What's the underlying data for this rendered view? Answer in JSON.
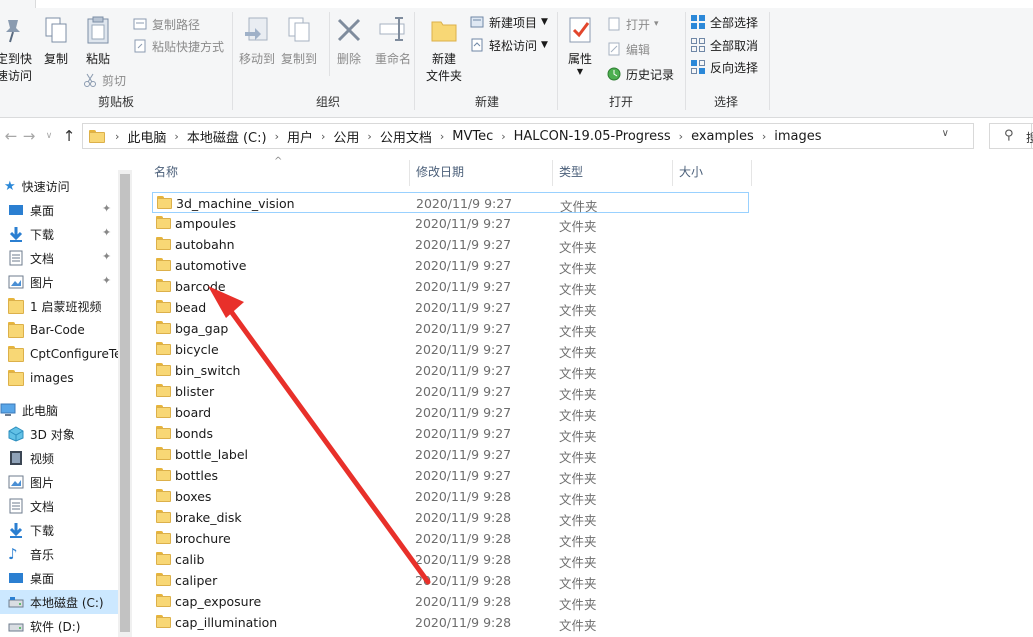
{
  "ribbon": {
    "clipboard": {
      "pin_label_1": "定到快",
      "pin_label_2": "速访问",
      "copy": "复制",
      "paste": "粘贴",
      "copy_path": "复制路径",
      "paste_shortcut": "粘贴快捷方式",
      "cut": "剪切",
      "group": "剪贴板"
    },
    "organize": {
      "move_to": "移动到",
      "copy_to": "复制到",
      "delete": "删除",
      "rename": "重命名",
      "group": "组织"
    },
    "new": {
      "new_folder_1": "新建",
      "new_folder_2": "文件夹",
      "new_item": "新建项目",
      "easy_access": "轻松访问",
      "group": "新建"
    },
    "open": {
      "properties": "属性",
      "open": "打开",
      "edit": "编辑",
      "history": "历史记录",
      "group": "打开"
    },
    "select": {
      "select_all": "全部选择",
      "select_none": "全部取消",
      "invert": "反向选择",
      "group": "选择"
    }
  },
  "address": {
    "crumbs": [
      "此电脑",
      "本地磁盘 (C:)",
      "用户",
      "公用",
      "公用文档",
      "MVTec",
      "HALCON-19.05-Progress",
      "examples",
      "images"
    ],
    "search_placeholder": "搜"
  },
  "nav": {
    "quick_access": "快速访问",
    "items": [
      {
        "label": "桌面",
        "icon": "desktop-icon",
        "pinned": true
      },
      {
        "label": "下载",
        "icon": "download-icon",
        "pinned": true
      },
      {
        "label": "文档",
        "icon": "document-icon",
        "pinned": true
      },
      {
        "label": "图片",
        "icon": "picture-icon",
        "pinned": true
      },
      {
        "label": "1 启蒙班视频",
        "icon": "folder-icon",
        "pinned": false
      },
      {
        "label": "Bar-Code",
        "icon": "folder-icon",
        "pinned": false
      },
      {
        "label": "CptConfigureTe",
        "icon": "folder-icon",
        "pinned": false
      },
      {
        "label": "images",
        "icon": "folder-icon",
        "pinned": false
      }
    ],
    "this_pc": "此电脑",
    "pc_items": [
      {
        "label": "3D 对象",
        "icon": "3d-objects-icon"
      },
      {
        "label": "视频",
        "icon": "video-icon"
      },
      {
        "label": "图片",
        "icon": "picture-icon"
      },
      {
        "label": "文档",
        "icon": "document-icon"
      },
      {
        "label": "下载",
        "icon": "download-icon"
      },
      {
        "label": "音乐",
        "icon": "music-icon"
      },
      {
        "label": "桌面",
        "icon": "desktop-icon"
      },
      {
        "label": "本地磁盘 (C:)",
        "icon": "drive-icon"
      },
      {
        "label": "软件 (D:)",
        "icon": "drive-icon"
      }
    ]
  },
  "columns": {
    "name": "名称",
    "date": "修改日期",
    "type": "类型",
    "size": "大小"
  },
  "files": [
    {
      "name": "3d_machine_vision",
      "date": "2020/11/9 9:27",
      "type": "文件夹"
    },
    {
      "name": "ampoules",
      "date": "2020/11/9 9:27",
      "type": "文件夹"
    },
    {
      "name": "autobahn",
      "date": "2020/11/9 9:27",
      "type": "文件夹"
    },
    {
      "name": "automotive",
      "date": "2020/11/9 9:27",
      "type": "文件夹"
    },
    {
      "name": "barcode",
      "date": "2020/11/9 9:27",
      "type": "文件夹"
    },
    {
      "name": "bead",
      "date": "2020/11/9 9:27",
      "type": "文件夹"
    },
    {
      "name": "bga_gap",
      "date": "2020/11/9 9:27",
      "type": "文件夹"
    },
    {
      "name": "bicycle",
      "date": "2020/11/9 9:27",
      "type": "文件夹"
    },
    {
      "name": "bin_switch",
      "date": "2020/11/9 9:27",
      "type": "文件夹"
    },
    {
      "name": "blister",
      "date": "2020/11/9 9:27",
      "type": "文件夹"
    },
    {
      "name": "board",
      "date": "2020/11/9 9:27",
      "type": "文件夹"
    },
    {
      "name": "bonds",
      "date": "2020/11/9 9:27",
      "type": "文件夹"
    },
    {
      "name": "bottle_label",
      "date": "2020/11/9 9:27",
      "type": "文件夹"
    },
    {
      "name": "bottles",
      "date": "2020/11/9 9:27",
      "type": "文件夹"
    },
    {
      "name": "boxes",
      "date": "2020/11/9 9:28",
      "type": "文件夹"
    },
    {
      "name": "brake_disk",
      "date": "2020/11/9 9:28",
      "type": "文件夹"
    },
    {
      "name": "brochure",
      "date": "2020/11/9 9:28",
      "type": "文件夹"
    },
    {
      "name": "calib",
      "date": "2020/11/9 9:28",
      "type": "文件夹"
    },
    {
      "name": "caliper",
      "date": "2020/11/9 9:28",
      "type": "文件夹"
    },
    {
      "name": "cap_exposure",
      "date": "2020/11/9 9:28",
      "type": "文件夹"
    },
    {
      "name": "cap_illumination",
      "date": "2020/11/9 9:28",
      "type": "文件夹"
    }
  ],
  "colors": {
    "accent": "#0078d7",
    "annotation_arrow": "#e8302a",
    "folder": "#f8d775",
    "selection": "#cce8ff"
  }
}
